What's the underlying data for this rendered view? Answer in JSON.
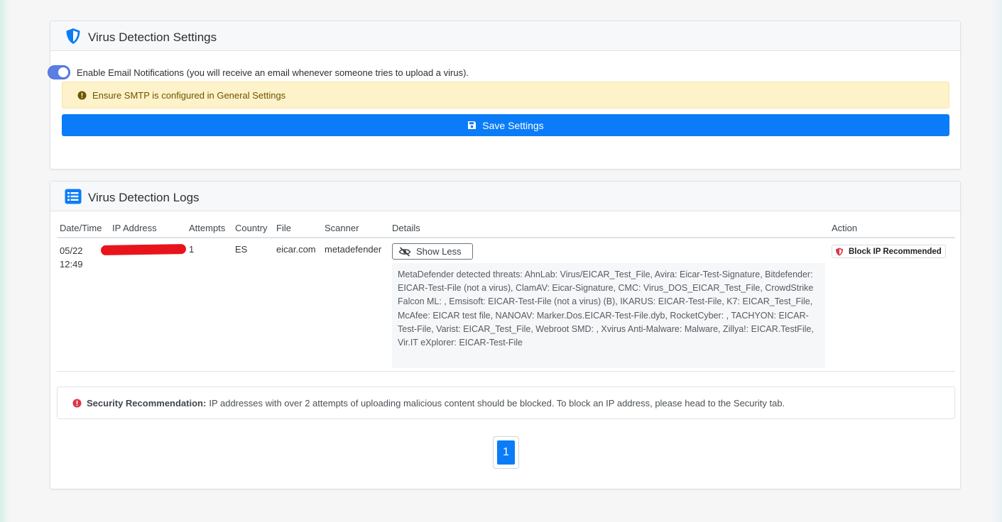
{
  "settings": {
    "title": "Virus Detection Settings",
    "title_icon": "shield-icon",
    "email_toggle_on": true,
    "email_toggle_label": "Enable Email Notifications (you will receive an email whenever someone tries to upload a virus).",
    "smtp_warning": "Ensure SMTP is configured in General Settings",
    "save_label": "Save Settings"
  },
  "logs": {
    "title": "Virus Detection Logs",
    "title_icon": "list-icon",
    "columns": {
      "datetime": "Date/Time",
      "ip": "IP Address",
      "attempts": "Attempts",
      "country": "Country",
      "file": "File",
      "scanner": "Scanner",
      "details": "Details",
      "action": "Action"
    },
    "rows": [
      {
        "date": "05/22",
        "time": "12:49",
        "ip": "",
        "attempts": "1",
        "country": "ES",
        "file": "eicar.com",
        "scanner": "metadefender",
        "toggle_label": "Show Less",
        "details": "MetaDefender detected threats: AhnLab: Virus/EICAR_Test_File, Avira: Eicar-Test-Signature, Bitdefender: EICAR-Test-File (not a virus), ClamAV: Eicar-Signature, CMC: Virus_DOS_EICAR_Test_File, CrowdStrike Falcon ML: , Emsisoft: EICAR-Test-File (not a virus) (B), IKARUS: EICAR-Test-File, K7: EICAR_Test_File, McAfee: EICAR test file, NANOAV: Marker.Dos.EICAR-Test-File.dyb, RocketCyber: , TACHYON: EICAR-Test-File, Varist: EICAR_Test_File, Webroot SMD: , Xvirus Anti-Malware: Malware, Zillya!: EICAR.TestFile, Vir.IT eXplorer: EICAR-Test-File",
        "action": "Block IP Recommended"
      }
    ],
    "recommendation_label": "Security Recommendation:",
    "recommendation_text": "IP addresses with over 2 attempts of uploading malicious content should be blocked. To block an IP address, please head to the Security tab.",
    "current_page": "1"
  },
  "colors": {
    "primary": "#0a7cf8",
    "toggle": "#5b7ee5",
    "warning_bg": "#fdf2c9",
    "danger": "#dc3545",
    "redaction": "#e8141c"
  }
}
